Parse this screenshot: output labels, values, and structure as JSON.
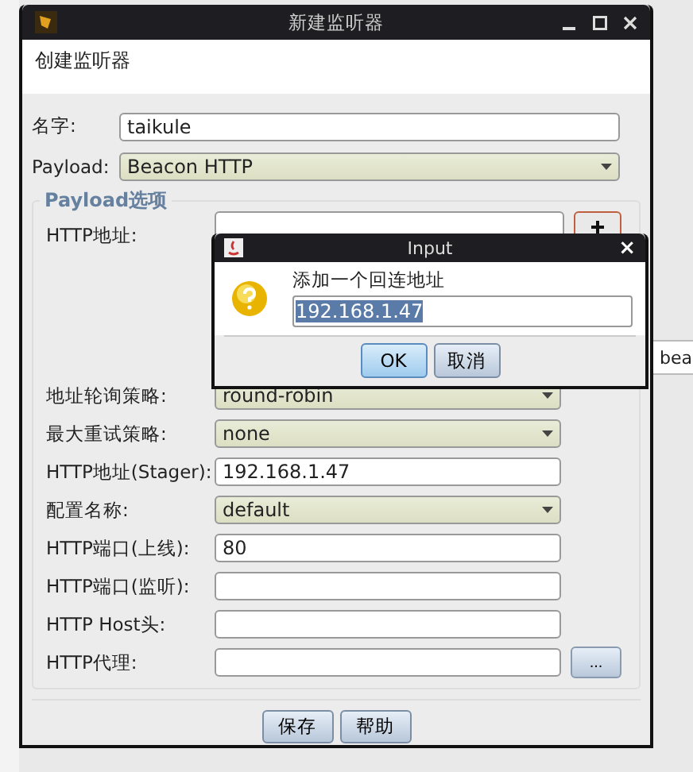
{
  "background": {
    "text": "bea"
  },
  "window": {
    "title": "新建监听器",
    "header": "创建监听器"
  },
  "top_fields": [
    {
      "label": "名字:",
      "kind": "text",
      "value": "taikule"
    },
    {
      "label": "Payload:",
      "kind": "combo",
      "value": "Beacon HTTP"
    }
  ],
  "group": {
    "title": "Payload选项",
    "address_list": {
      "label": "HTTP地址:"
    },
    "fields": [
      {
        "label": "地址轮询策略:",
        "kind": "combo",
        "value": "round-robin"
      },
      {
        "label": "最大重试策略:",
        "kind": "combo",
        "value": "none"
      },
      {
        "label": "HTTP地址(Stager):",
        "kind": "text",
        "value": "192.168.1.47"
      },
      {
        "label": "配置名称:",
        "kind": "combo",
        "value": "default"
      },
      {
        "label": "HTTP端口(上线):",
        "kind": "text",
        "value": "80"
      },
      {
        "label": "HTTP端口(监听):",
        "kind": "text"
      },
      {
        "label": "HTTP Host头:",
        "kind": "text"
      },
      {
        "label": "HTTP代理:",
        "kind": "text",
        "button": "..."
      }
    ]
  },
  "buttons": [
    "保存",
    "帮助"
  ],
  "dialog": {
    "title": "Input",
    "close": "×",
    "message": "添加一个回连地址",
    "value": "192.168.1.47",
    "value_selected": true,
    "buttons": [
      "OK",
      "取消"
    ]
  }
}
